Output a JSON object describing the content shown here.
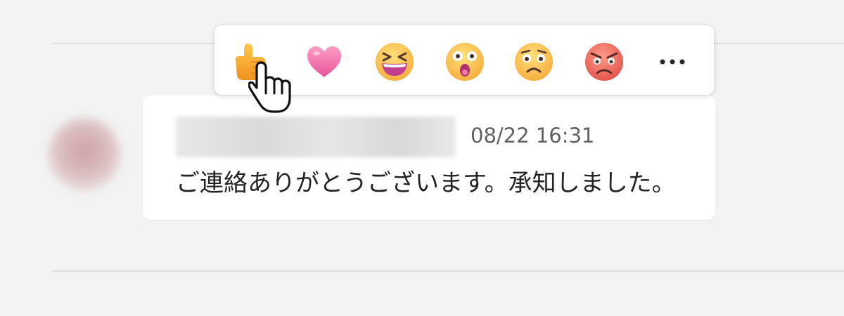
{
  "message": {
    "author": "",
    "timestamp": "08/22 16:31",
    "text": "ご連絡ありがとうございます。承知しました。"
  },
  "reactions": [
    {
      "name": "like",
      "icon": "thumbs-up-icon"
    },
    {
      "name": "heart",
      "icon": "heart-icon"
    },
    {
      "name": "laugh",
      "icon": "laughing-face-icon"
    },
    {
      "name": "surprised",
      "icon": "surprised-face-icon"
    },
    {
      "name": "sad",
      "icon": "sad-face-icon"
    },
    {
      "name": "angry",
      "icon": "angry-face-icon"
    }
  ],
  "more_button": {
    "icon": "more-options-icon"
  },
  "colors": {
    "background": "#f3f3f3",
    "card": "#ffffff",
    "timestamp_text": "#616161",
    "message_text": "#242424"
  }
}
